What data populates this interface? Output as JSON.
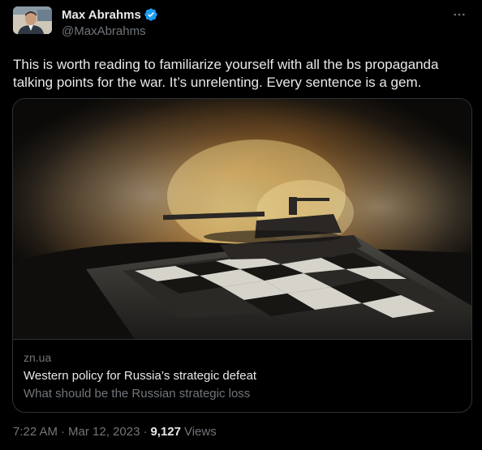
{
  "author": {
    "display_name": "Max Abrahms",
    "handle": "@MaxAbrahms",
    "verified_icon": "verified-badge-icon",
    "avatar_icon": "avatar-photo"
  },
  "tweet": {
    "text": "This is worth reading to familiarize yourself with all the bs propaganda talking points for the war. It’s unrelenting. Every sentence is a gem."
  },
  "link_card": {
    "domain": "zn.ua",
    "title": "Western policy for Russia’s strategic defeat",
    "description": "What should be the Russian strategic loss",
    "image_icon": "tank-on-chessboard-explosion-image"
  },
  "meta": {
    "time": "7:22 AM",
    "separator1": "·",
    "date": "Mar 12, 2023",
    "separator2": "·",
    "views_count": "9,127",
    "views_label": "Views"
  },
  "more_icon": "more-dots-icon",
  "colors": {
    "background": "#000000",
    "text_primary": "#e7e9ea",
    "text_secondary": "#71767b",
    "border": "#2f3336",
    "verified": "#1d9bf0"
  }
}
